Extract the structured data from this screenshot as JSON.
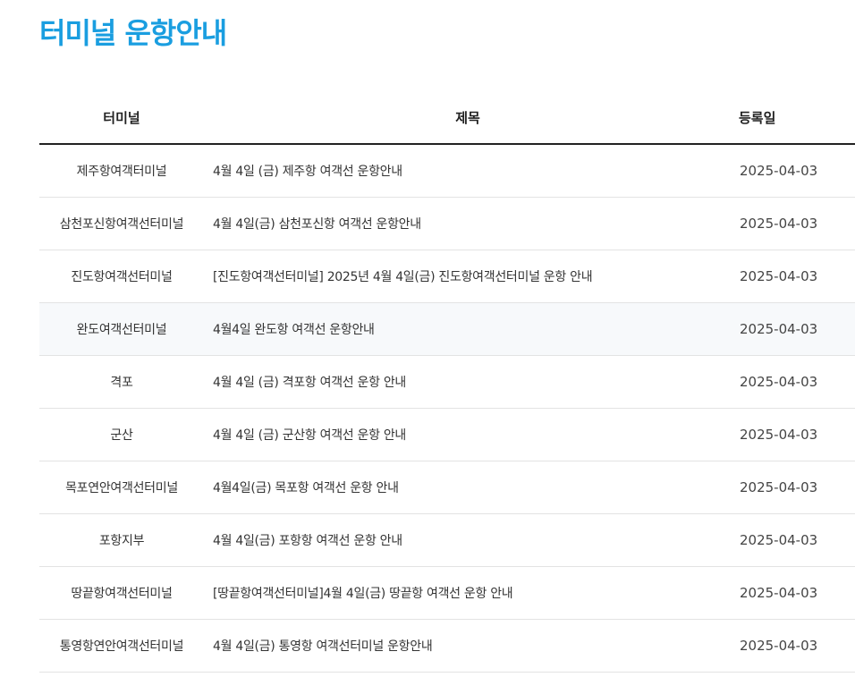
{
  "page": {
    "title": "터미널 운항안내"
  },
  "table": {
    "headers": {
      "terminal": "터미널",
      "subject": "제목",
      "date": "등록일"
    },
    "rows": [
      {
        "terminal": "제주항여객터미널",
        "subject": "4월 4일 (금) 제주항 여객선 운항안내",
        "date": "2025-04-03"
      },
      {
        "terminal": "삼천포신항여객선터미널",
        "subject": "4월 4일(금) 삼천포신항 여객선 운항안내",
        "date": "2025-04-03"
      },
      {
        "terminal": "진도항여객선터미널",
        "subject": "[진도항여객선터미널] 2025년 4월 4일(금) 진도항여객선터미널 운항 안내",
        "date": "2025-04-03"
      },
      {
        "terminal": "완도여객선터미널",
        "subject": "4월4일 완도항 여객선 운항안내",
        "date": "2025-04-03"
      },
      {
        "terminal": "격포",
        "subject": "4월 4일 (금) 격포항 여객선 운항 안내",
        "date": "2025-04-03"
      },
      {
        "terminal": "군산",
        "subject": "4월 4일 (금) 군산항 여객선 운항 안내",
        "date": "2025-04-03"
      },
      {
        "terminal": "목포연안여객선터미널",
        "subject": "4월4일(금) 목포항 여객선 운항 안내",
        "date": "2025-04-03"
      },
      {
        "terminal": "포항지부",
        "subject": "4월 4일(금) 포항항 여객선 운항 안내",
        "date": "2025-04-03"
      },
      {
        "terminal": "땅끝항여객선터미널",
        "subject": "[땅끝항여객선터미널]4월 4일(금) 땅끝항 여객선 운항 안내",
        "date": "2025-04-03"
      },
      {
        "terminal": "통영항연안여객선터미널",
        "subject": "4월 4일(금) 통영항 여객선터미널 운항안내",
        "date": "2025-04-03"
      }
    ]
  },
  "colors": {
    "title": "#1a9ee0",
    "header_rule": "#222222",
    "row_rule": "#e3e3e3",
    "highlight_row": "#f7f9fb"
  }
}
